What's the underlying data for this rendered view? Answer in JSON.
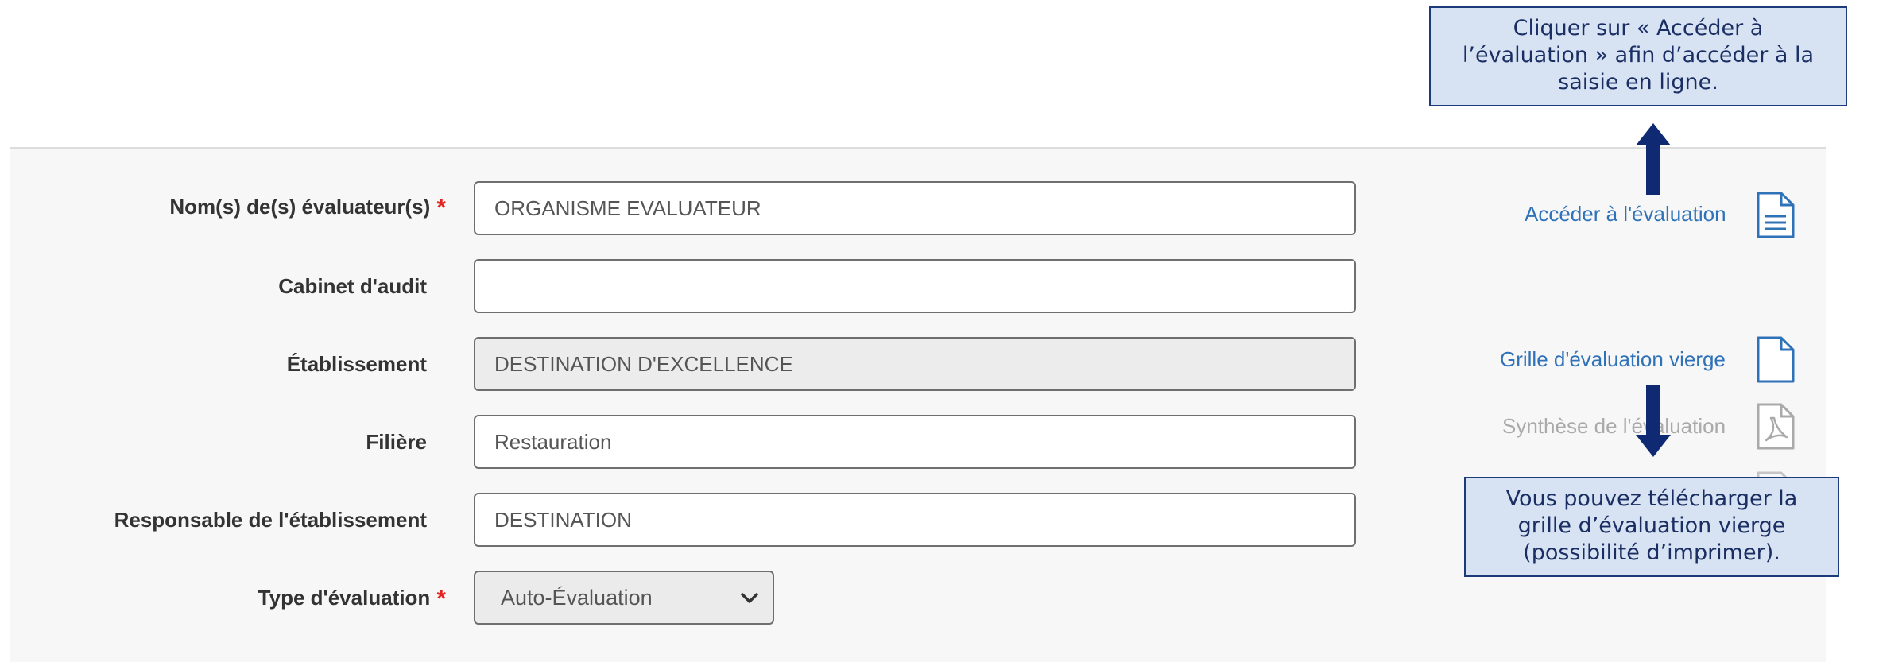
{
  "form": {
    "rows": [
      {
        "label": "Nom(s) de(s) évaluateur(s)",
        "value": "ORGANISME EVALUATEUR",
        "required_mark": "*"
      },
      {
        "label": "Cabinet d'audit",
        "value": ""
      },
      {
        "label": "Établissement",
        "value": "DESTINATION D'EXCELLENCE"
      },
      {
        "label": "Filière",
        "value": "Restauration"
      },
      {
        "label": "Responsable de l'établissement",
        "value": "DESTINATION"
      },
      {
        "label": "Type d'évaluation",
        "value": "Auto-Évaluation",
        "required_mark": "*"
      }
    ]
  },
  "actions": {
    "access": {
      "label": "Accéder à l'évaluation",
      "icon": "document-lines-icon"
    },
    "blank_grid": {
      "label": "Grille d'évaluation vierge",
      "icon": "document-blank-icon"
    },
    "summary": {
      "label": "Synthèse de l'évaluation",
      "icon": "pdf-icon"
    }
  },
  "callouts": {
    "access": {
      "lines": [
        "Cliquer sur « Accéder à",
        "l’évaluation » afin d’accéder à la",
        "saisie en ligne."
      ]
    },
    "download": {
      "lines": [
        "Vous pouvez télécharger la",
        "grille d’évaluation vierge",
        "(possibilité d’imprimer)."
      ]
    }
  },
  "colors": {
    "link": "#2f72b8",
    "link_disabled": "#aaaaaa",
    "required": "#e52222",
    "callout_bg": "#d7e3f3",
    "callout_border": "#1d3a7a",
    "arrow": "#0f2a72"
  }
}
